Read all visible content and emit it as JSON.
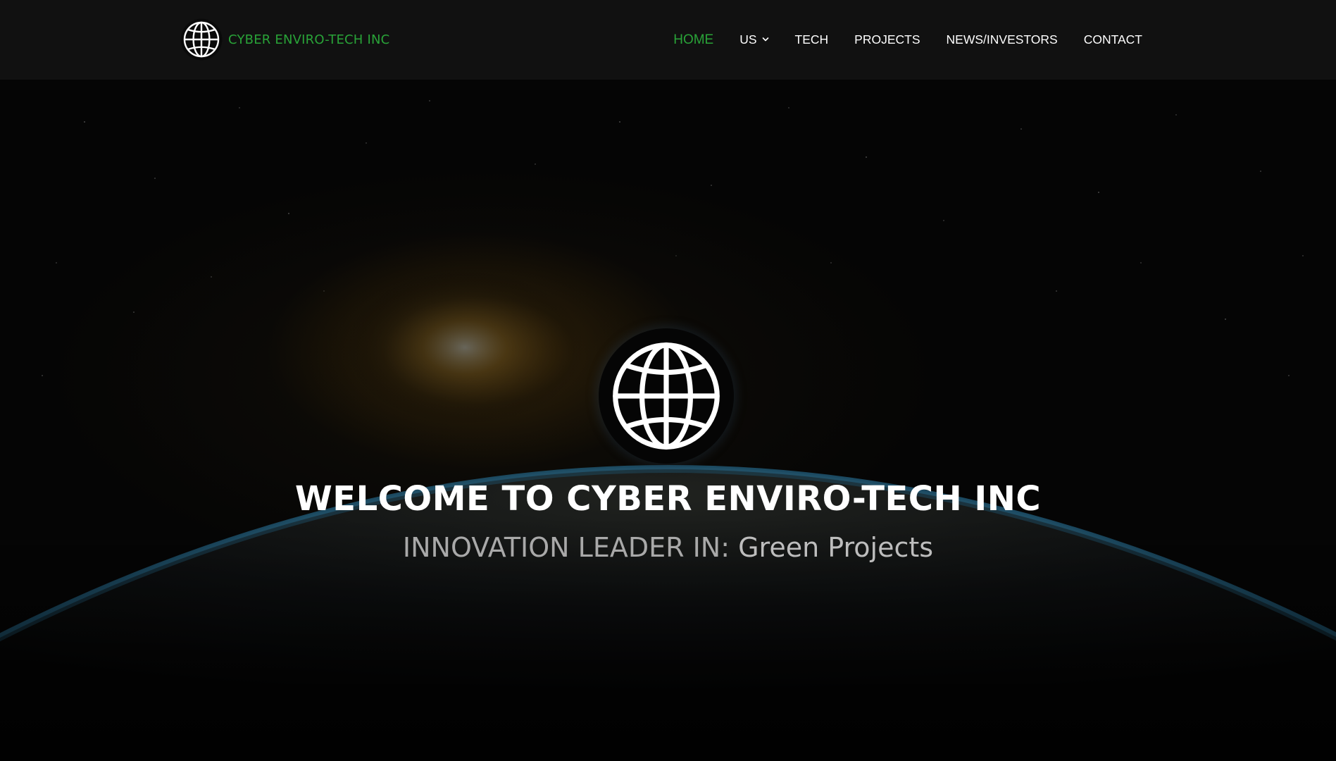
{
  "header": {
    "brand_name": "CYBER ENVIRO-TECH INC",
    "brand_logo_icon": "globe-icon"
  },
  "nav": {
    "items": [
      {
        "label": "HOME",
        "active": true
      },
      {
        "label": "US",
        "has_dropdown": true
      },
      {
        "label": "TECH"
      },
      {
        "label": "PROJECTS"
      },
      {
        "label": "NEWS/INVESTORS"
      },
      {
        "label": "CONTACT"
      }
    ]
  },
  "hero": {
    "icon": "globe-icon",
    "title": "WELCOME TO CYBER ENVIRO-TECH INC",
    "subtitle_prefix": "INNOVATION LEADER IN: ",
    "subtitle_rotating": "Green Projects"
  },
  "colors": {
    "header_bg": "#111111",
    "brand_green": "#29a338",
    "nav_text": "#ffffff",
    "hero_title": "#ffffff",
    "hero_subtitle": "#a9a9a9",
    "earth_rim": "#2b7ea8"
  }
}
